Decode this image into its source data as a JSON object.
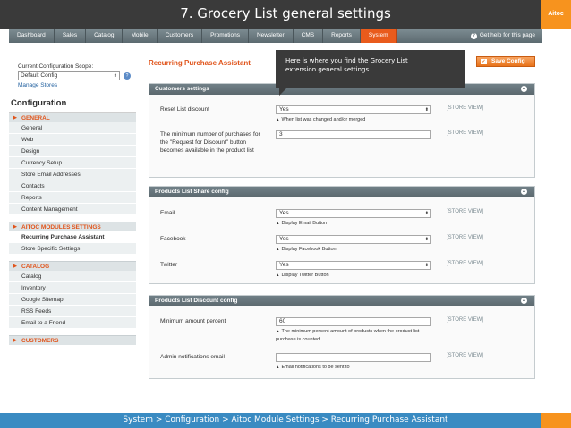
{
  "slide": {
    "title": "7. Grocery List general settings",
    "brand": "Aitoc",
    "footer": "System > Configuration > Aitoc Module Settings > Recurring Purchase Assistant"
  },
  "nav": {
    "items": [
      "Dashboard",
      "Sales",
      "Catalog",
      "Mobile",
      "Customers",
      "Promotions",
      "Newsletter",
      "CMS",
      "Reports",
      "System"
    ],
    "active": "System",
    "help": "Get help for this page"
  },
  "sidebar": {
    "scope_label": "Current Configuration Scope:",
    "scope_value": "Default Config",
    "manage_stores": "Manage Stores",
    "heading": "Configuration",
    "general": {
      "title": "GENERAL",
      "items": [
        "General",
        "Web",
        "Design",
        "Currency Setup",
        "Store Email Addresses",
        "Contacts",
        "Reports",
        "Content Management"
      ]
    },
    "aitoc": {
      "title": "AITOC MODULES SETTINGS",
      "items": [
        "Recurring Purchase Assistant",
        "Store Specific Settings"
      ]
    },
    "catalog": {
      "title": "CATALOG",
      "items": [
        "Catalog",
        "Inventory",
        "Google Sitemap",
        "RSS Feeds",
        "Email to a Friend"
      ]
    },
    "customers": {
      "title": "CUSTOMERS"
    }
  },
  "main": {
    "title": "Recurring Purchase Assistant",
    "save_label": "Save Config",
    "callout": [
      "Here is where you find the Grocery List",
      "extension general settings."
    ],
    "store_view": "[STORE VIEW]",
    "customers": {
      "title": "Customers settings",
      "reset_label": "Reset List discount",
      "reset_value": "Yes",
      "reset_hint": "When list was changed and/or merged",
      "min_label": "The minimum number of purchases for the \"Request for Discount\" button becomes available in the product list",
      "min_value": "3"
    },
    "share": {
      "title": "Products List Share config",
      "email_label": "Email",
      "email_value": "Yes",
      "email_hint": "Display Email Button",
      "facebook_label": "Facebook",
      "facebook_value": "Yes",
      "facebook_hint": "Display Facebook Button",
      "twitter_label": "Twitter",
      "twitter_value": "Yes",
      "twitter_hint": "Display Twitter Button"
    },
    "discount": {
      "title": "Products List Discount config",
      "min_label": "Minimum amount percent",
      "min_value": "60",
      "min_hint": "The minimum percent amount of products when the product list purchase is counted",
      "admin_label": "Admin notifications email",
      "admin_value": "",
      "admin_hint": "Email notifications to be sent to"
    }
  }
}
